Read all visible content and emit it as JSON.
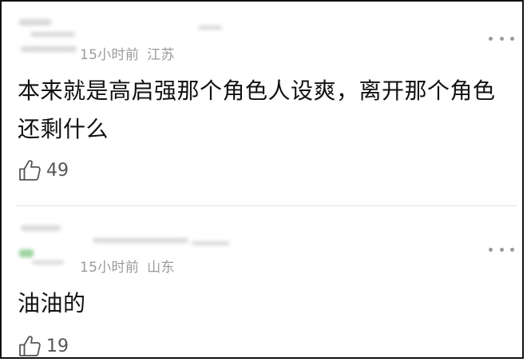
{
  "comments": [
    {
      "time": "15小时前",
      "location": "江苏",
      "text": "本来就是高启强那个角色人设爽，离开那个角色还剩什么",
      "like_count": "49",
      "like_icon": "thumbs-up-icon",
      "more_icon": "more-dots-icon"
    },
    {
      "time": "15小时前",
      "location": "山东",
      "text": "油油的",
      "like_count": "19",
      "like_icon": "thumbs-up-icon",
      "more_icon": "more-dots-icon"
    }
  ]
}
